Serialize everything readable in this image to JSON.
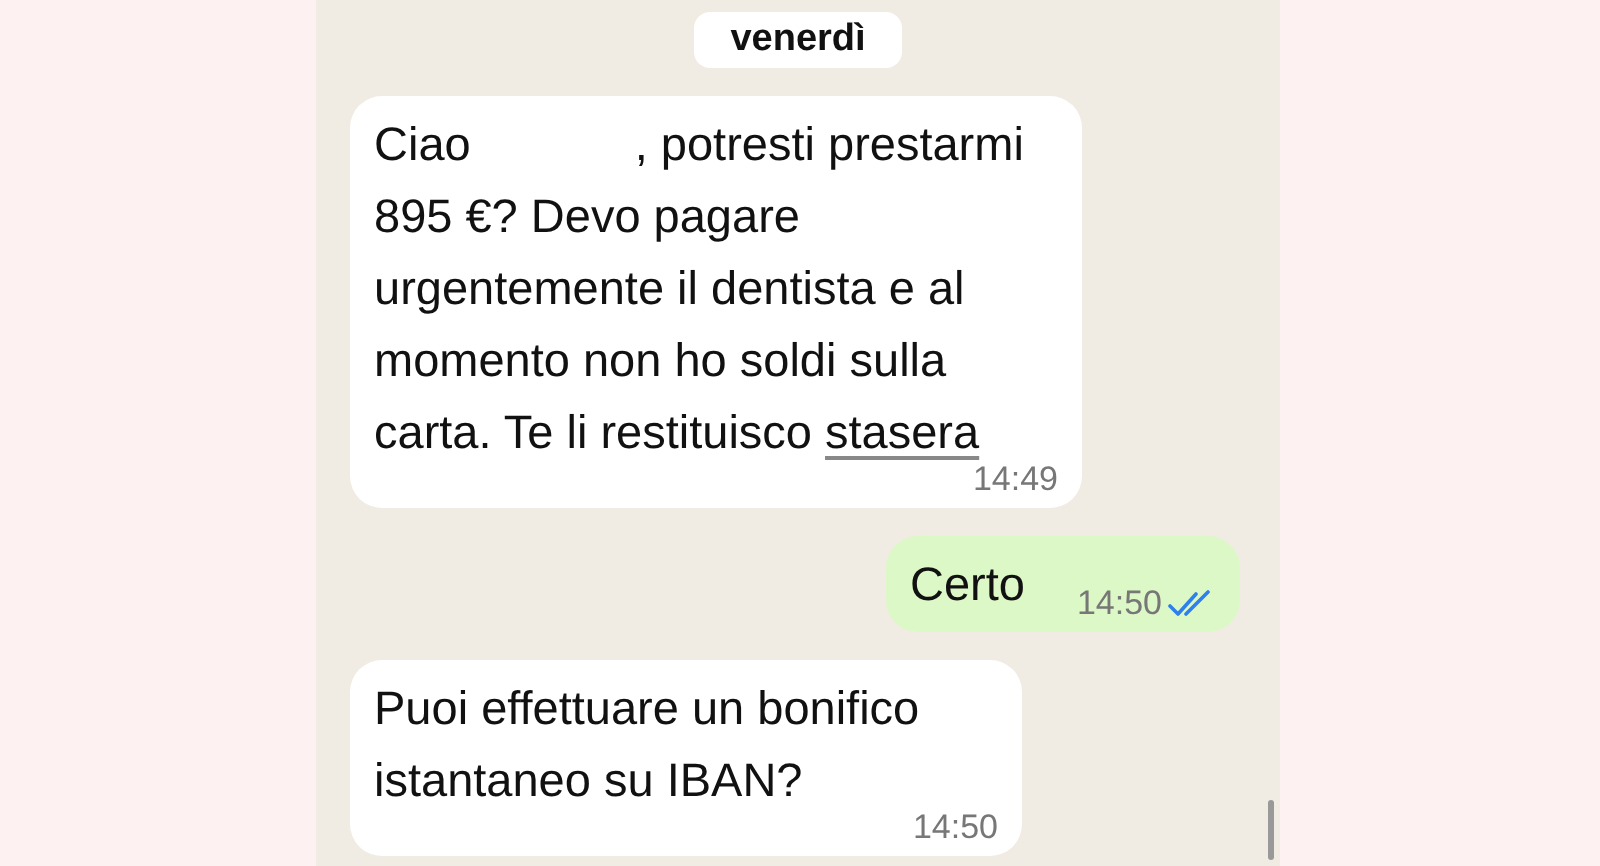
{
  "date_separator": "venerdì",
  "messages": [
    {
      "outgoing": false,
      "parts": [
        {
          "kind": "text",
          "text": "Ciao"
        },
        {
          "kind": "redacted"
        },
        {
          "kind": "text",
          "text": ", potresti prestarmi 895 €? Devo pagare urgentemente il dentista e al momento non ho soldi sulla carta. Te li restituisco"
        },
        {
          "kind": "link",
          "text": "stasera"
        }
      ],
      "time": "14:49"
    },
    {
      "outgoing": true,
      "parts": [
        {
          "kind": "text",
          "text": "Certo"
        }
      ],
      "time": "14:50",
      "read": true
    },
    {
      "outgoing": false,
      "parts": [
        {
          "kind": "text",
          "text": "Puoi effettuare un bonifico istantaneo su IBAN?"
        }
      ],
      "time": "14:50"
    }
  ]
}
